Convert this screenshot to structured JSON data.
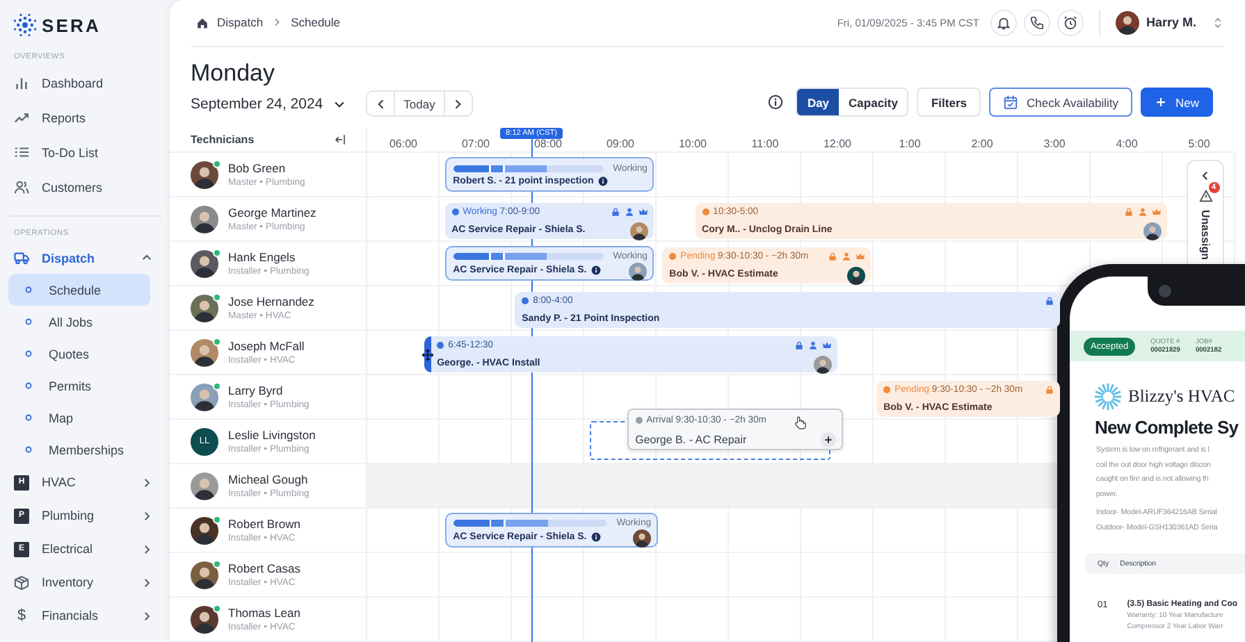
{
  "sidebar": {
    "logo": "SERA",
    "sections": [
      {
        "heading": "OVERVIEWS",
        "items": [
          {
            "label": "Dashboard",
            "selected": false
          },
          {
            "label": "Reports",
            "selected": false
          },
          {
            "label": "To-Do List",
            "selected": false
          },
          {
            "label": "Customers",
            "selected": false
          }
        ]
      },
      {
        "heading": "OPERATIONS",
        "items": [
          {
            "label": "Dispatch",
            "selected": true,
            "expanded": true,
            "children": [
              {
                "label": "Schedule",
                "selected": true
              },
              {
                "label": "All Jobs",
                "selected": false
              },
              {
                "label": "Quotes",
                "selected": false
              },
              {
                "label": "Permits",
                "selected": false
              },
              {
                "label": "Map",
                "selected": false
              },
              {
                "label": "Memberships",
                "selected": false
              }
            ]
          },
          {
            "label": "HVAC",
            "badge": "H",
            "selected": false,
            "expanded": false
          },
          {
            "label": "Plumbing",
            "badge": "P",
            "selected": false,
            "expanded": false
          },
          {
            "label": "Electrical",
            "badge": "E",
            "selected": false,
            "expanded": false
          },
          {
            "label": "Inventory",
            "selected": false,
            "expanded": false
          },
          {
            "label": "Financials",
            "glyph": "$",
            "selected": false,
            "expanded": false
          }
        ]
      }
    ]
  },
  "header": {
    "breadcrumb": [
      "Dispatch",
      "Schedule"
    ],
    "datetime": "Fri, 01/09/2025 - 3:45 PM CST",
    "user": "Harry M."
  },
  "toolbar": {
    "day": "Monday",
    "date": "September 24, 2024",
    "today": "Today",
    "views": [
      {
        "label": "Day",
        "selected": true
      },
      {
        "label": "Capacity",
        "selected": false
      }
    ],
    "filters": "Filters",
    "check_availability": "Check Availability",
    "new": "New"
  },
  "timeline": {
    "heading": "Technicians",
    "hours": [
      "06:00",
      "07:00",
      "08:00",
      "09:00",
      "10:00",
      "11:00",
      "12:00",
      "1:00",
      "2:00",
      "3:00",
      "4:00",
      "5:00"
    ],
    "now": {
      "label": "8:12 AM (CST)"
    },
    "technicians": [
      {
        "name": "Bob Green",
        "role": "Master • Plumbing",
        "online": true,
        "events": [
          {
            "kind": "progress",
            "color": "#86a9ea",
            "status": "Working",
            "title": "Robert S. - 21 point inspection",
            "info": true,
            "level": 0.62
          }
        ]
      },
      {
        "name": "George Martinez",
        "role": "Master • Plumbing",
        "online": false,
        "events": [
          {
            "kind": "booked",
            "color": "#3a70e0",
            "status": "Working",
            "time": "7:00-9:00",
            "locked": true,
            "assigned": true,
            "priority": true,
            "title": "AC Service Repair - Shiela S.",
            "avatar": true
          },
          {
            "kind": "booked",
            "color": "#f0893a",
            "time": "10:30-5:00",
            "locked": true,
            "assigned": true,
            "priority": true,
            "title": "Cory M.. - Unclog Drain Line",
            "avatar": true
          }
        ]
      },
      {
        "name": "Hank Engels",
        "role": "Installer • Plumbing",
        "online": true,
        "events": [
          {
            "kind": "progress",
            "color": "#86a9ea",
            "status": "Working",
            "title": "AC Service Repair - Shiela S.",
            "info": true,
            "avatar": true,
            "level": 0.62
          },
          {
            "kind": "booked",
            "color": "#f0893a",
            "status": "Pending",
            "time": "9:30-10:30 - ~2h 30m",
            "locked": true,
            "assigned": true,
            "priority": true,
            "title": "Bob V. - HVAC Estimate",
            "avatar": true
          }
        ]
      },
      {
        "name": "Jose Hernandez",
        "role": "Master • HVAC",
        "online": true,
        "events": [
          {
            "kind": "booked",
            "color": "#3a70e0",
            "time": "8:00-4:00",
            "locked": true,
            "title": "Sandy P. - 21 Point Inspection"
          }
        ]
      },
      {
        "name": "Joseph McFall",
        "role": "Installer • HVAC",
        "online": true,
        "events": [
          {
            "kind": "booked",
            "color": "#3a70e0",
            "time": "6:45-12:30",
            "locked": true,
            "assigned": true,
            "priority": true,
            "title": "George. - HVAC Install",
            "avatar": true,
            "handle": true
          }
        ]
      },
      {
        "name": "Larry Byrd",
        "role": "Installer • Plumbing",
        "online": true,
        "events": [
          {
            "kind": "booked",
            "color": "#f0893a",
            "status": "Pending",
            "time": "9:30-10:30 - ~2h 30m",
            "locked": true,
            "title": "Bob V. - HVAC Estimate"
          }
        ]
      },
      {
        "name": "Leslie Livingston",
        "role": "Installer • Plumbing",
        "online": false,
        "initials": "LL",
        "events": [
          {
            "kind": "ghost",
            "color": "#9a9ea6",
            "status": "Arrival",
            "time": "9:30-10:30 - ~2h 30m",
            "title": "George B. - AC Repair"
          }
        ]
      },
      {
        "name": "Micheal Gough",
        "role": "Installer • Plumbing",
        "online": false,
        "unavailable": true
      },
      {
        "name": "Robert Brown",
        "role": "Installer • HVAC",
        "online": true,
        "events": [
          {
            "kind": "progress",
            "color": "#86a9ea",
            "status": "Working",
            "title": "AC Service Repair - Shiela S.",
            "info": true,
            "avatar": true,
            "level": 0.62
          }
        ]
      },
      {
        "name": "Robert Casas",
        "role": "Installer • HVAC",
        "online": true
      },
      {
        "name": "Thomas Lean",
        "role": "Installer • HVAC",
        "online": true
      }
    ]
  },
  "unassigned_tab": {
    "label": "Unassign",
    "count": "4"
  },
  "phone_preview": {
    "status": "Accepted",
    "quote_label": "QUOTE #",
    "quote": "00021829",
    "job_label": "JOB#",
    "job": "0002182",
    "company": "Blizzy's HVAC",
    "title": "New Complete Sy",
    "description": [
      "System is low on refrigerant and is l",
      "coil the out door high voltage discon",
      "caught on fire and is not allowing th",
      "power."
    ],
    "models": [
      "Indoor- Model-ARUF364216AB Serial",
      "Outdoor- Model-GSH130361AD Seria"
    ],
    "columns": [
      "Qty",
      "Description"
    ],
    "line_item": {
      "qty": "01",
      "name": "(3.5) Basic Heating and Coo",
      "details": [
        "Warranty: 10 Year Manufacture",
        "Compressor 2 Year Labor Warr"
      ]
    }
  }
}
